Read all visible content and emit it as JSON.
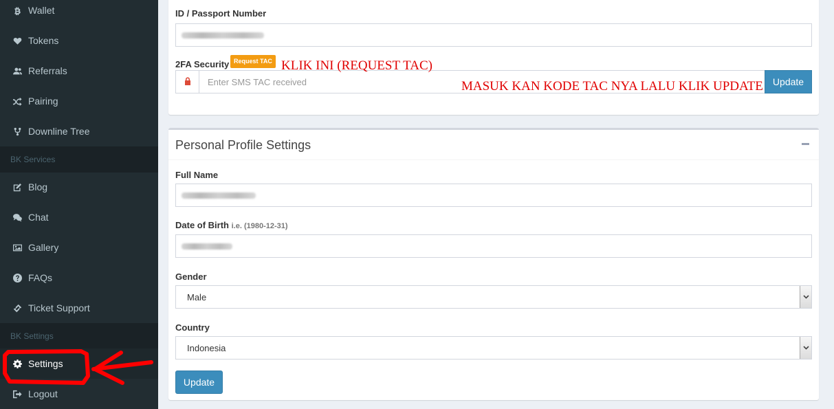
{
  "sidebar": {
    "items_top": [
      {
        "label": "Wallet",
        "icon": "bitcoin-icon"
      },
      {
        "label": "Tokens",
        "icon": "heart-icon"
      },
      {
        "label": "Referrals",
        "icon": "users-icon"
      },
      {
        "label": "Pairing",
        "icon": "random-icon"
      },
      {
        "label": "Downline Tree",
        "icon": "code-fork-icon"
      }
    ],
    "section_services": "BK Services",
    "items_services": [
      {
        "label": "Blog",
        "icon": "edit-icon"
      },
      {
        "label": "Chat",
        "icon": "chat-icon"
      },
      {
        "label": "Gallery",
        "icon": "image-icon"
      },
      {
        "label": "FAQs",
        "icon": "question-circle-icon"
      },
      {
        "label": "Ticket Support",
        "icon": "ticket-icon"
      }
    ],
    "section_settings": "BK Settings",
    "items_settings": [
      {
        "label": "Settings",
        "icon": "gear-icon",
        "active": true
      },
      {
        "label": "Logout",
        "icon": "sign-out-icon"
      }
    ]
  },
  "security_box": {
    "id_label": "ID / Passport Number",
    "twofa_label": "2FA Security",
    "request_tac_label": "Request TAC",
    "tac_placeholder": "Enter SMS TAC received",
    "update_label": "Update"
  },
  "profile_box": {
    "title": "Personal Profile Settings",
    "full_name_label": "Full Name",
    "dob_label": "Date of Birth",
    "dob_hint": "i.e. (1980-12-31)",
    "gender_label": "Gender",
    "gender_value": "Male",
    "country_label": "Country",
    "country_value": "Indonesia",
    "update_label": "Update"
  },
  "annotations": {
    "request_tac_note": "KLIK INI (REQUEST TAC)",
    "enter_tac_note": "MASUK KAN KODE TAC NYA LALU KLIK UPDATE"
  },
  "colors": {
    "sidebar_bg": "#222d32",
    "primary": "#3c8dbc",
    "warning": "#f39c12",
    "annotation_red": "#e00000"
  }
}
